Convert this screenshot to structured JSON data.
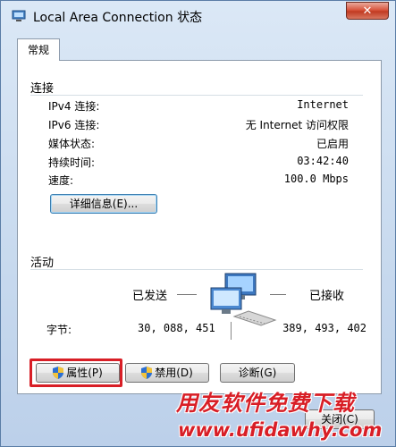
{
  "window": {
    "title": "Local Area Connection 状态",
    "close_label": "✕"
  },
  "tabs": [
    {
      "label": "常规"
    }
  ],
  "connection": {
    "section_title": "连接",
    "rows": [
      {
        "label": "IPv4 连接:",
        "value": "Internet"
      },
      {
        "label": "IPv6 连接:",
        "value": "无 Internet 访问权限"
      },
      {
        "label": "媒体状态:",
        "value": "已启用"
      },
      {
        "label": "持续时间:",
        "value": "03:42:40"
      },
      {
        "label": "速度:",
        "value": "100.0 Mbps"
      }
    ],
    "details_button": "详细信息(E)..."
  },
  "activity": {
    "section_title": "活动",
    "sent_label": "已发送",
    "received_label": "已接收",
    "bytes_label": "字节:",
    "bytes_sent": "30, 088, 451",
    "bytes_received": "389, 493, 402"
  },
  "buttons": {
    "properties": "属性(P)",
    "disable": "禁用(D)",
    "diagnose": "诊断(G)",
    "close": "关闭(C)"
  },
  "watermark": {
    "line1": "用友软件免费下载",
    "line2": "www.ufidawhy.com"
  },
  "colors": {
    "highlight": "#d81e26",
    "watermark": "#d81e26"
  }
}
